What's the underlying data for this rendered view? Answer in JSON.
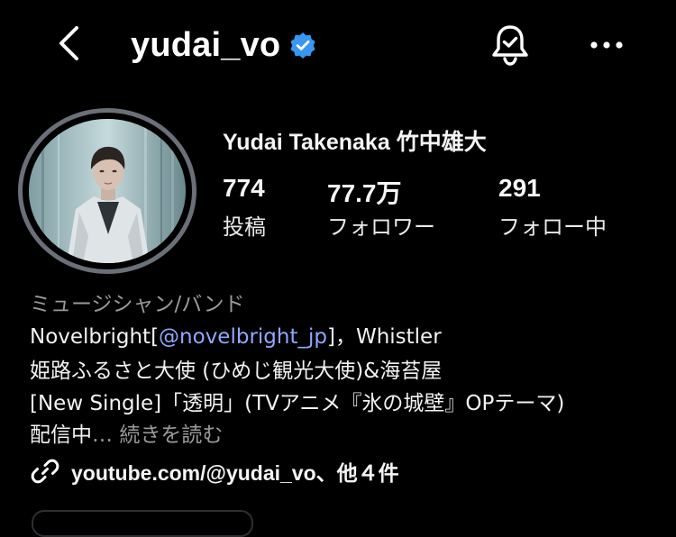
{
  "header": {
    "username": "yudai_vo"
  },
  "profile": {
    "display_name": "Yudai Takenaka 竹中雄大",
    "stats": [
      {
        "value": "774",
        "label": "投稿"
      },
      {
        "value": "77.7万",
        "label": "フォロワー"
      },
      {
        "value": "291",
        "label": "フォロー中"
      }
    ]
  },
  "bio": {
    "category": "ミュージシャン/バンド",
    "line1_prefix": "Novelbright[",
    "line1_mention": "@novelbright_jp",
    "line1_suffix": "]，Whistler",
    "line2": "姫路ふるさと大使 (ひめじ観光大使)&海苔屋",
    "line3": "[New Single]「透明」(TVアニメ『氷の城壁』OPテーマ)",
    "line4": "配信中",
    "ellipsis": "…",
    "read_more": "続きを読む"
  },
  "link": {
    "text": "youtube.com/@yudai_vo、他４件"
  },
  "icons": {
    "back": "chevron-left-icon",
    "verified": "verified-badge-icon",
    "bell": "bell-check-icon",
    "more": "more-horizontal-icon",
    "link": "link-icon"
  },
  "colors": {
    "background": "#000000",
    "verified": "#3897f0",
    "mention": "#8fa8ff",
    "muted": "#9a9a9a"
  }
}
